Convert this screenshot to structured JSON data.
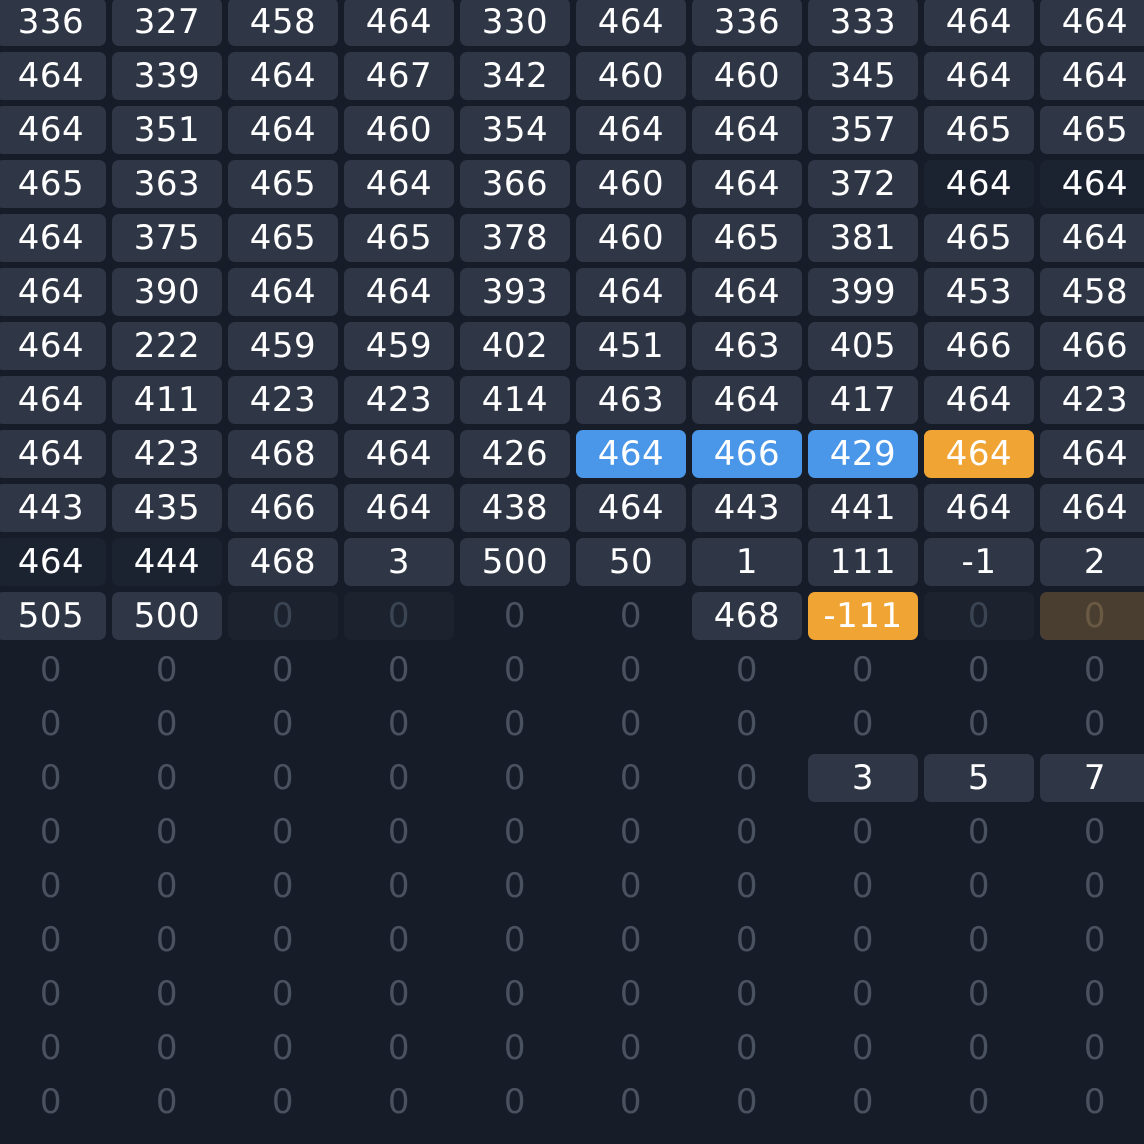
{
  "palette": {
    "background": "#161d28",
    "cell": "#2f3645",
    "highlight_blue": "#4a96e9",
    "highlight_orange": "#f0a433"
  },
  "grid": {
    "columns": 10,
    "rows": [
      [
        "336",
        "327",
        "458",
        "464",
        "330",
        "464",
        "336",
        "333",
        "464",
        "464"
      ],
      [
        "464",
        "339",
        "464",
        "467",
        "342",
        "460",
        "460",
        "345",
        "464",
        "464"
      ],
      [
        "464",
        "351",
        "464",
        "460",
        "354",
        "464",
        "464",
        "357",
        "465",
        "465"
      ],
      [
        "465",
        "363",
        "465",
        "464",
        "366",
        "460",
        "464",
        "372",
        "464",
        "464"
      ],
      [
        "464",
        "375",
        "465",
        "465",
        "378",
        "460",
        "465",
        "381",
        "465",
        "464"
      ],
      [
        "464",
        "390",
        "464",
        "464",
        "393",
        "464",
        "464",
        "399",
        "453",
        "458"
      ],
      [
        "464",
        "222",
        "459",
        "459",
        "402",
        "451",
        "463",
        "405",
        "466",
        "466"
      ],
      [
        "464",
        "411",
        "423",
        "423",
        "414",
        "463",
        "464",
        "417",
        "464",
        "423"
      ],
      [
        "464",
        "423",
        "468",
        "464",
        "426",
        "464",
        "466",
        "429",
        "464",
        "464"
      ],
      [
        "443",
        "435",
        "466",
        "464",
        "438",
        "464",
        "443",
        "441",
        "464",
        "464"
      ],
      [
        "464",
        "444",
        "468",
        "3",
        "500",
        "50",
        "1",
        "111",
        "-1",
        "2"
      ],
      [
        "505",
        "500",
        "0",
        "0",
        "0",
        "0",
        "468",
        "-111",
        "0",
        "0"
      ],
      [
        "0",
        "0",
        "0",
        "0",
        "0",
        "0",
        "0",
        "0",
        "0",
        "0"
      ],
      [
        "0",
        "0",
        "0",
        "0",
        "0",
        "0",
        "0",
        "0",
        "0",
        "0"
      ],
      [
        "0",
        "0",
        "0",
        "0",
        "0",
        "0",
        "0",
        "3",
        "5",
        "7"
      ],
      [
        "0",
        "0",
        "0",
        "0",
        "0",
        "0",
        "0",
        "0",
        "0",
        "0"
      ],
      [
        "0",
        "0",
        "0",
        "0",
        "0",
        "0",
        "0",
        "0",
        "0",
        "0"
      ],
      [
        "0",
        "0",
        "0",
        "0",
        "0",
        "0",
        "0",
        "0",
        "0",
        "0"
      ],
      [
        "0",
        "0",
        "0",
        "0",
        "0",
        "0",
        "0",
        "0",
        "0",
        "0"
      ],
      [
        "0",
        "0",
        "0",
        "0",
        "0",
        "0",
        "0",
        "0",
        "0",
        "0"
      ],
      [
        "0",
        "0",
        "0",
        "0",
        "0",
        "0",
        "0",
        "0",
        "0",
        "0"
      ]
    ],
    "styles": [
      [
        "filled",
        "filled",
        "filled",
        "filled",
        "filled",
        "filled",
        "filled",
        "filled",
        "filled",
        "filled"
      ],
      [
        "filled",
        "filled",
        "filled",
        "filled",
        "filled",
        "filled",
        "filled",
        "filled",
        "filled",
        "filled"
      ],
      [
        "filled",
        "filled",
        "filled",
        "filled",
        "filled",
        "filled",
        "filled",
        "filled",
        "filled",
        "filled"
      ],
      [
        "filled",
        "filled",
        "filled",
        "filled",
        "filled",
        "filled",
        "filled",
        "filled",
        "dark",
        "dark"
      ],
      [
        "filled",
        "filled",
        "filled",
        "filled",
        "filled",
        "filled",
        "filled",
        "filled",
        "filled",
        "filled"
      ],
      [
        "filled",
        "filled",
        "filled",
        "filled",
        "filled",
        "filled",
        "filled",
        "filled",
        "filled",
        "filled"
      ],
      [
        "filled",
        "filled",
        "filled",
        "filled",
        "filled",
        "filled",
        "filled",
        "filled",
        "filled",
        "filled"
      ],
      [
        "filled",
        "filled",
        "filled",
        "filled",
        "filled",
        "filled",
        "filled",
        "filled",
        "filled",
        "filled"
      ],
      [
        "filled",
        "filled",
        "filled",
        "filled",
        "filled",
        "blue",
        "blue",
        "blue",
        "orange",
        "filled"
      ],
      [
        "filled",
        "filled",
        "filled",
        "filled",
        "filled",
        "filled",
        "filled",
        "filled",
        "filled",
        "filled"
      ],
      [
        "dark",
        "dark",
        "filled",
        "filled",
        "filled",
        "filled",
        "filled",
        "filled",
        "filled",
        "filled"
      ],
      [
        "filled",
        "filled",
        "zero",
        "zero",
        "empty",
        "empty",
        "filled",
        "orange",
        "zero",
        "brownzero"
      ],
      [
        "empty",
        "empty",
        "empty",
        "empty",
        "empty",
        "empty",
        "empty",
        "empty",
        "empty",
        "empty"
      ],
      [
        "empty",
        "empty",
        "empty",
        "empty",
        "empty",
        "empty",
        "empty",
        "empty",
        "empty",
        "empty"
      ],
      [
        "empty",
        "empty",
        "empty",
        "empty",
        "empty",
        "empty",
        "empty",
        "filled",
        "filled",
        "filled"
      ],
      [
        "empty",
        "empty",
        "empty",
        "empty",
        "empty",
        "empty",
        "empty",
        "empty",
        "empty",
        "empty"
      ],
      [
        "empty",
        "empty",
        "empty",
        "empty",
        "empty",
        "empty",
        "empty",
        "empty",
        "empty",
        "empty"
      ],
      [
        "empty",
        "empty",
        "empty",
        "empty",
        "empty",
        "empty",
        "empty",
        "empty",
        "empty",
        "empty"
      ],
      [
        "empty",
        "empty",
        "empty",
        "empty",
        "empty",
        "empty",
        "empty",
        "empty",
        "empty",
        "empty"
      ],
      [
        "empty",
        "empty",
        "empty",
        "empty",
        "empty",
        "empty",
        "empty",
        "empty",
        "empty",
        "empty"
      ],
      [
        "empty",
        "empty",
        "empty",
        "empty",
        "empty",
        "empty",
        "empty",
        "empty",
        "empty",
        "empty"
      ]
    ]
  }
}
